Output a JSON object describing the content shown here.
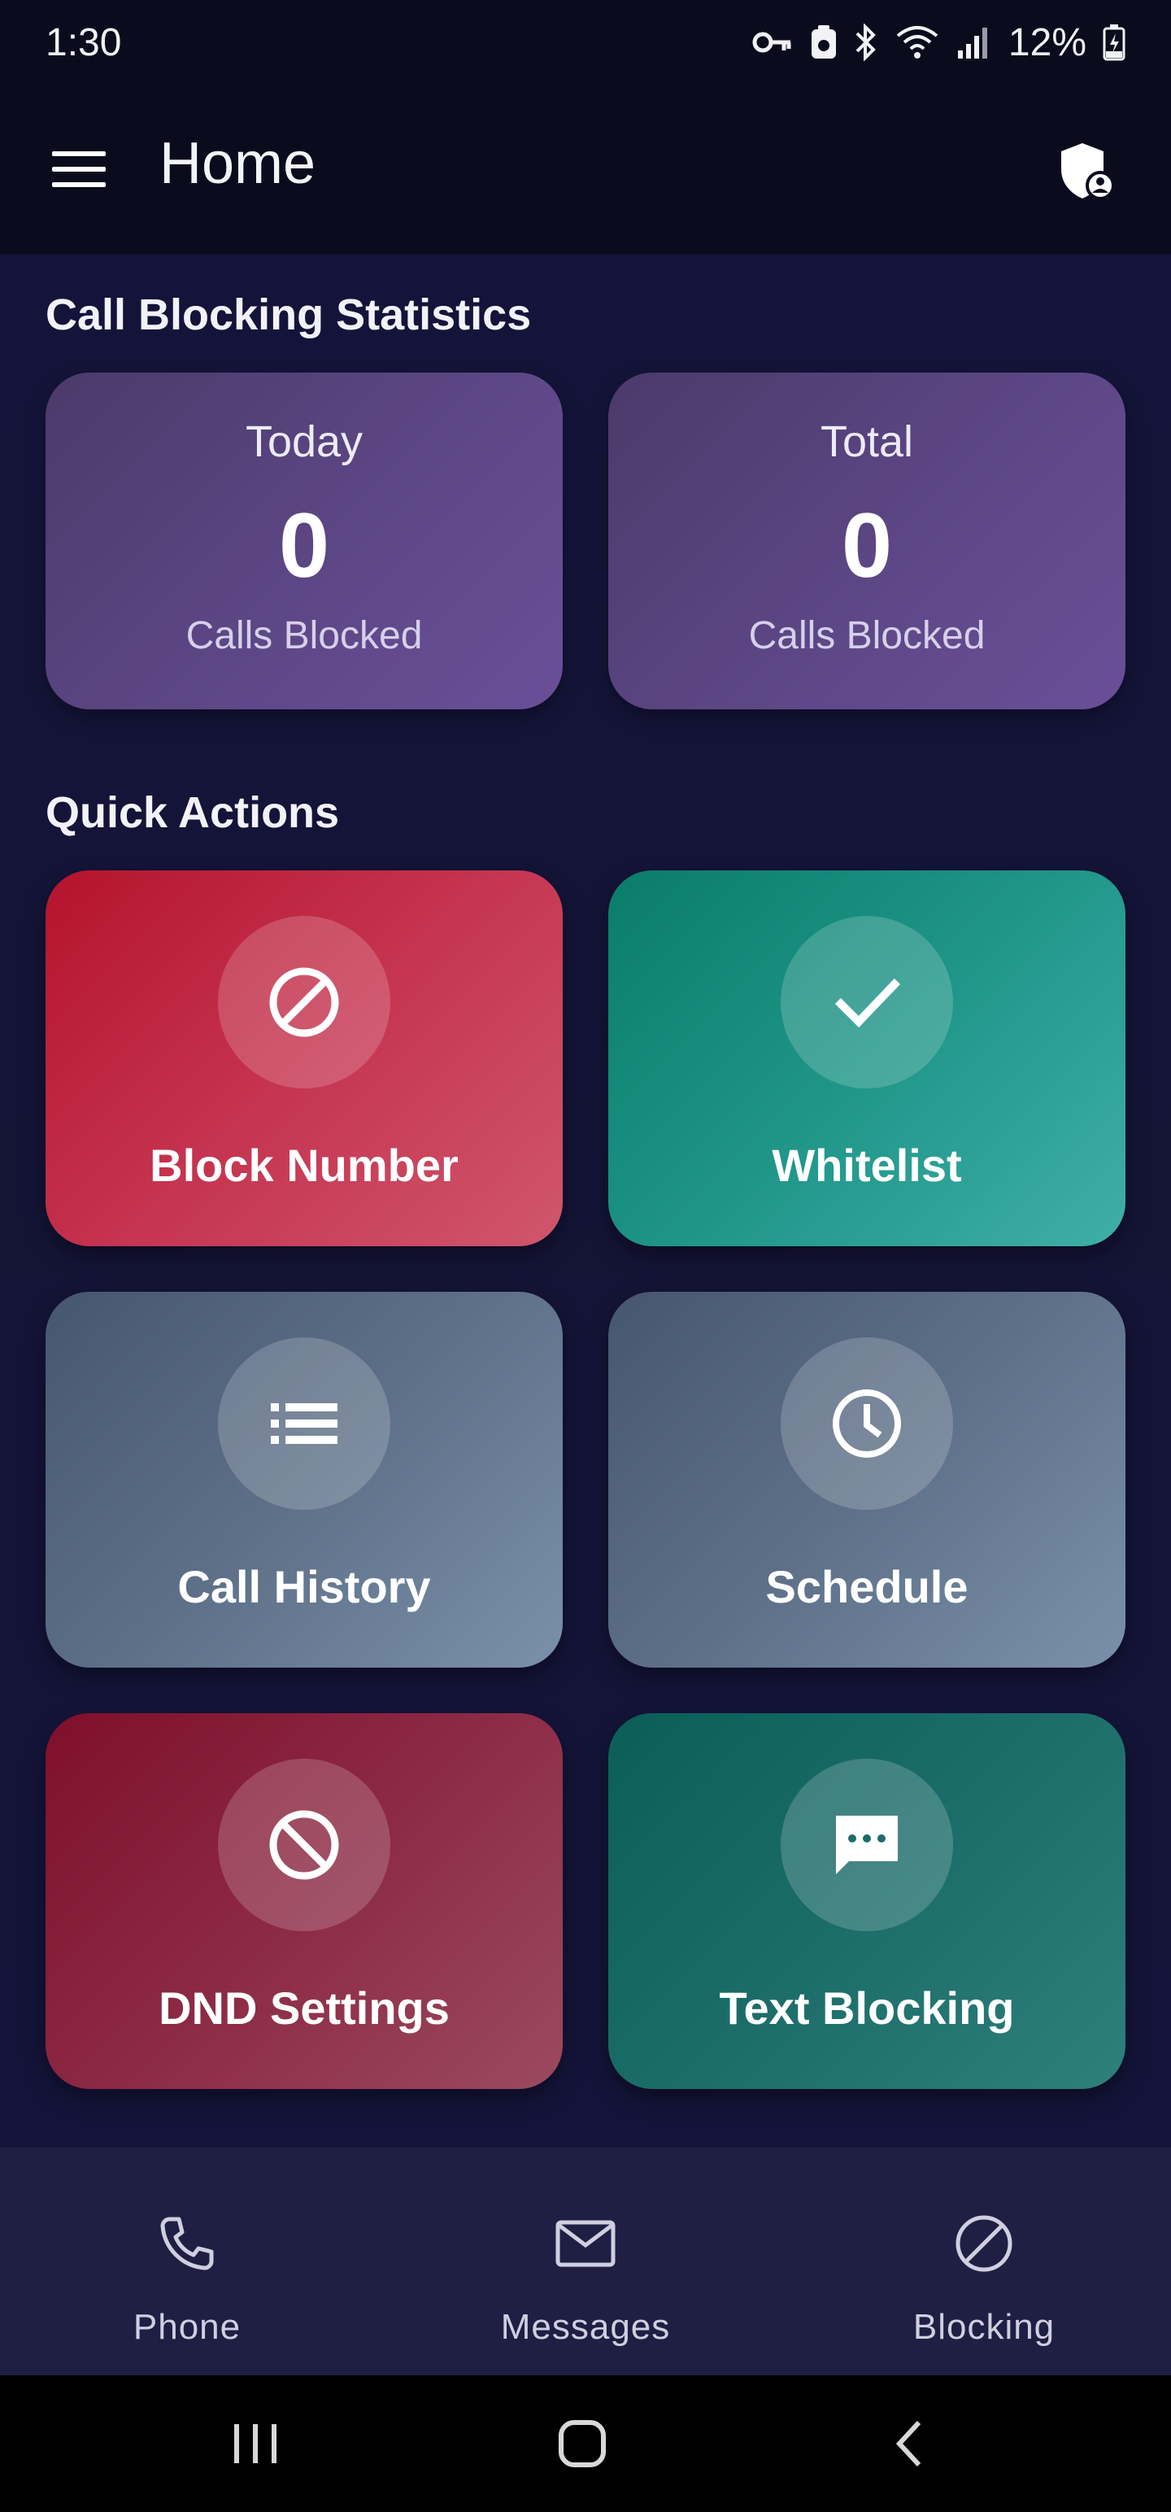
{
  "status_bar": {
    "time": "1:30",
    "battery": "12%"
  },
  "app_bar": {
    "title": "Home"
  },
  "stats": {
    "section_title": "Call Blocking Statistics",
    "cards": [
      {
        "label": "Today",
        "value": "0",
        "sub": "Calls Blocked"
      },
      {
        "label": "Total",
        "value": "0",
        "sub": "Calls Blocked"
      }
    ]
  },
  "quick_actions": {
    "section_title": "Quick Actions",
    "items": [
      {
        "label": "Block Number",
        "icon": "block-icon",
        "color": "#c53450"
      },
      {
        "label": "Whitelist",
        "icon": "check-icon",
        "color": "#1f9588"
      },
      {
        "label": "Call History",
        "icon": "list-icon",
        "color": "#5e7088"
      },
      {
        "label": "Schedule",
        "icon": "clock-icon",
        "color": "#5e7088"
      },
      {
        "label": "DND Settings",
        "icon": "do-not-disturb-icon",
        "color": "#8c2a45"
      },
      {
        "label": "Text Blocking",
        "icon": "message-icon",
        "color": "#1c6d6a"
      }
    ]
  },
  "bottom_nav": {
    "items": [
      {
        "label": "Phone",
        "icon": "phone-icon"
      },
      {
        "label": "Messages",
        "icon": "mail-icon"
      },
      {
        "label": "Blocking",
        "icon": "block-icon"
      }
    ]
  }
}
